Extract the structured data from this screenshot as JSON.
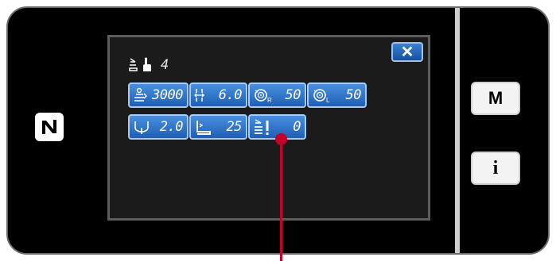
{
  "colors": {
    "accent": "#2a6fc9",
    "screen_bg": "#1b1b1b",
    "callout": "#c4002b"
  },
  "close_button": {
    "label": "✕"
  },
  "title": {
    "icon": "presser-foot-hand-icon",
    "number": "4"
  },
  "params": [
    {
      "icon": "presser-foot-speed-icon",
      "value": "3000"
    },
    {
      "icon": "stitch-pitch-icon",
      "value": "6.0"
    },
    {
      "icon": "right-tension-icon",
      "sub": "R",
      "value": "50"
    },
    {
      "icon": "left-tension-icon",
      "sub": "L",
      "value": "50"
    },
    {
      "icon": "hook-icon",
      "value": "2.0"
    },
    {
      "icon": "presser-foot-pressure-icon",
      "value": "25"
    },
    {
      "icon": "presser-foot-lift-icon",
      "value": "0"
    }
  ],
  "side_buttons": {
    "mode": "M",
    "info": "i"
  },
  "icons": {
    "nfc": "nfc-logo-icon"
  }
}
